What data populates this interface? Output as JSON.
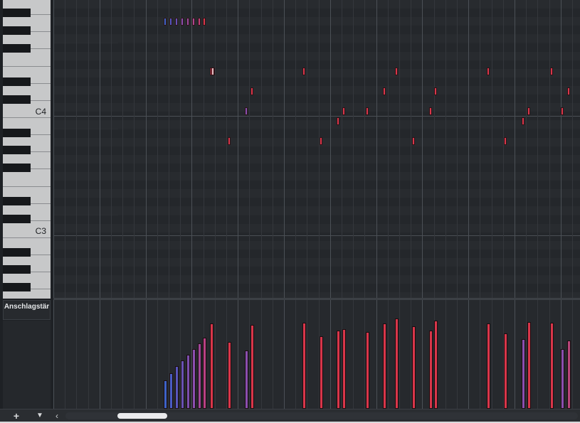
{
  "keyboard": {
    "labels": [
      "C4",
      "C3"
    ]
  },
  "velocity_lane": {
    "label": "Anschlagstär"
  },
  "toolbar": {
    "add_icon": "plus-icon",
    "add_glyph": "+",
    "menu_icon": "triangle-down-icon",
    "menu_glyph": "▼"
  },
  "scroll": {
    "left_glyph": "‹"
  },
  "colors": {
    "note_red": "#d8364a",
    "note_purple": "#8a4fb0",
    "note_blue": "#3d63c8",
    "grid_bg": "#26292d"
  }
}
